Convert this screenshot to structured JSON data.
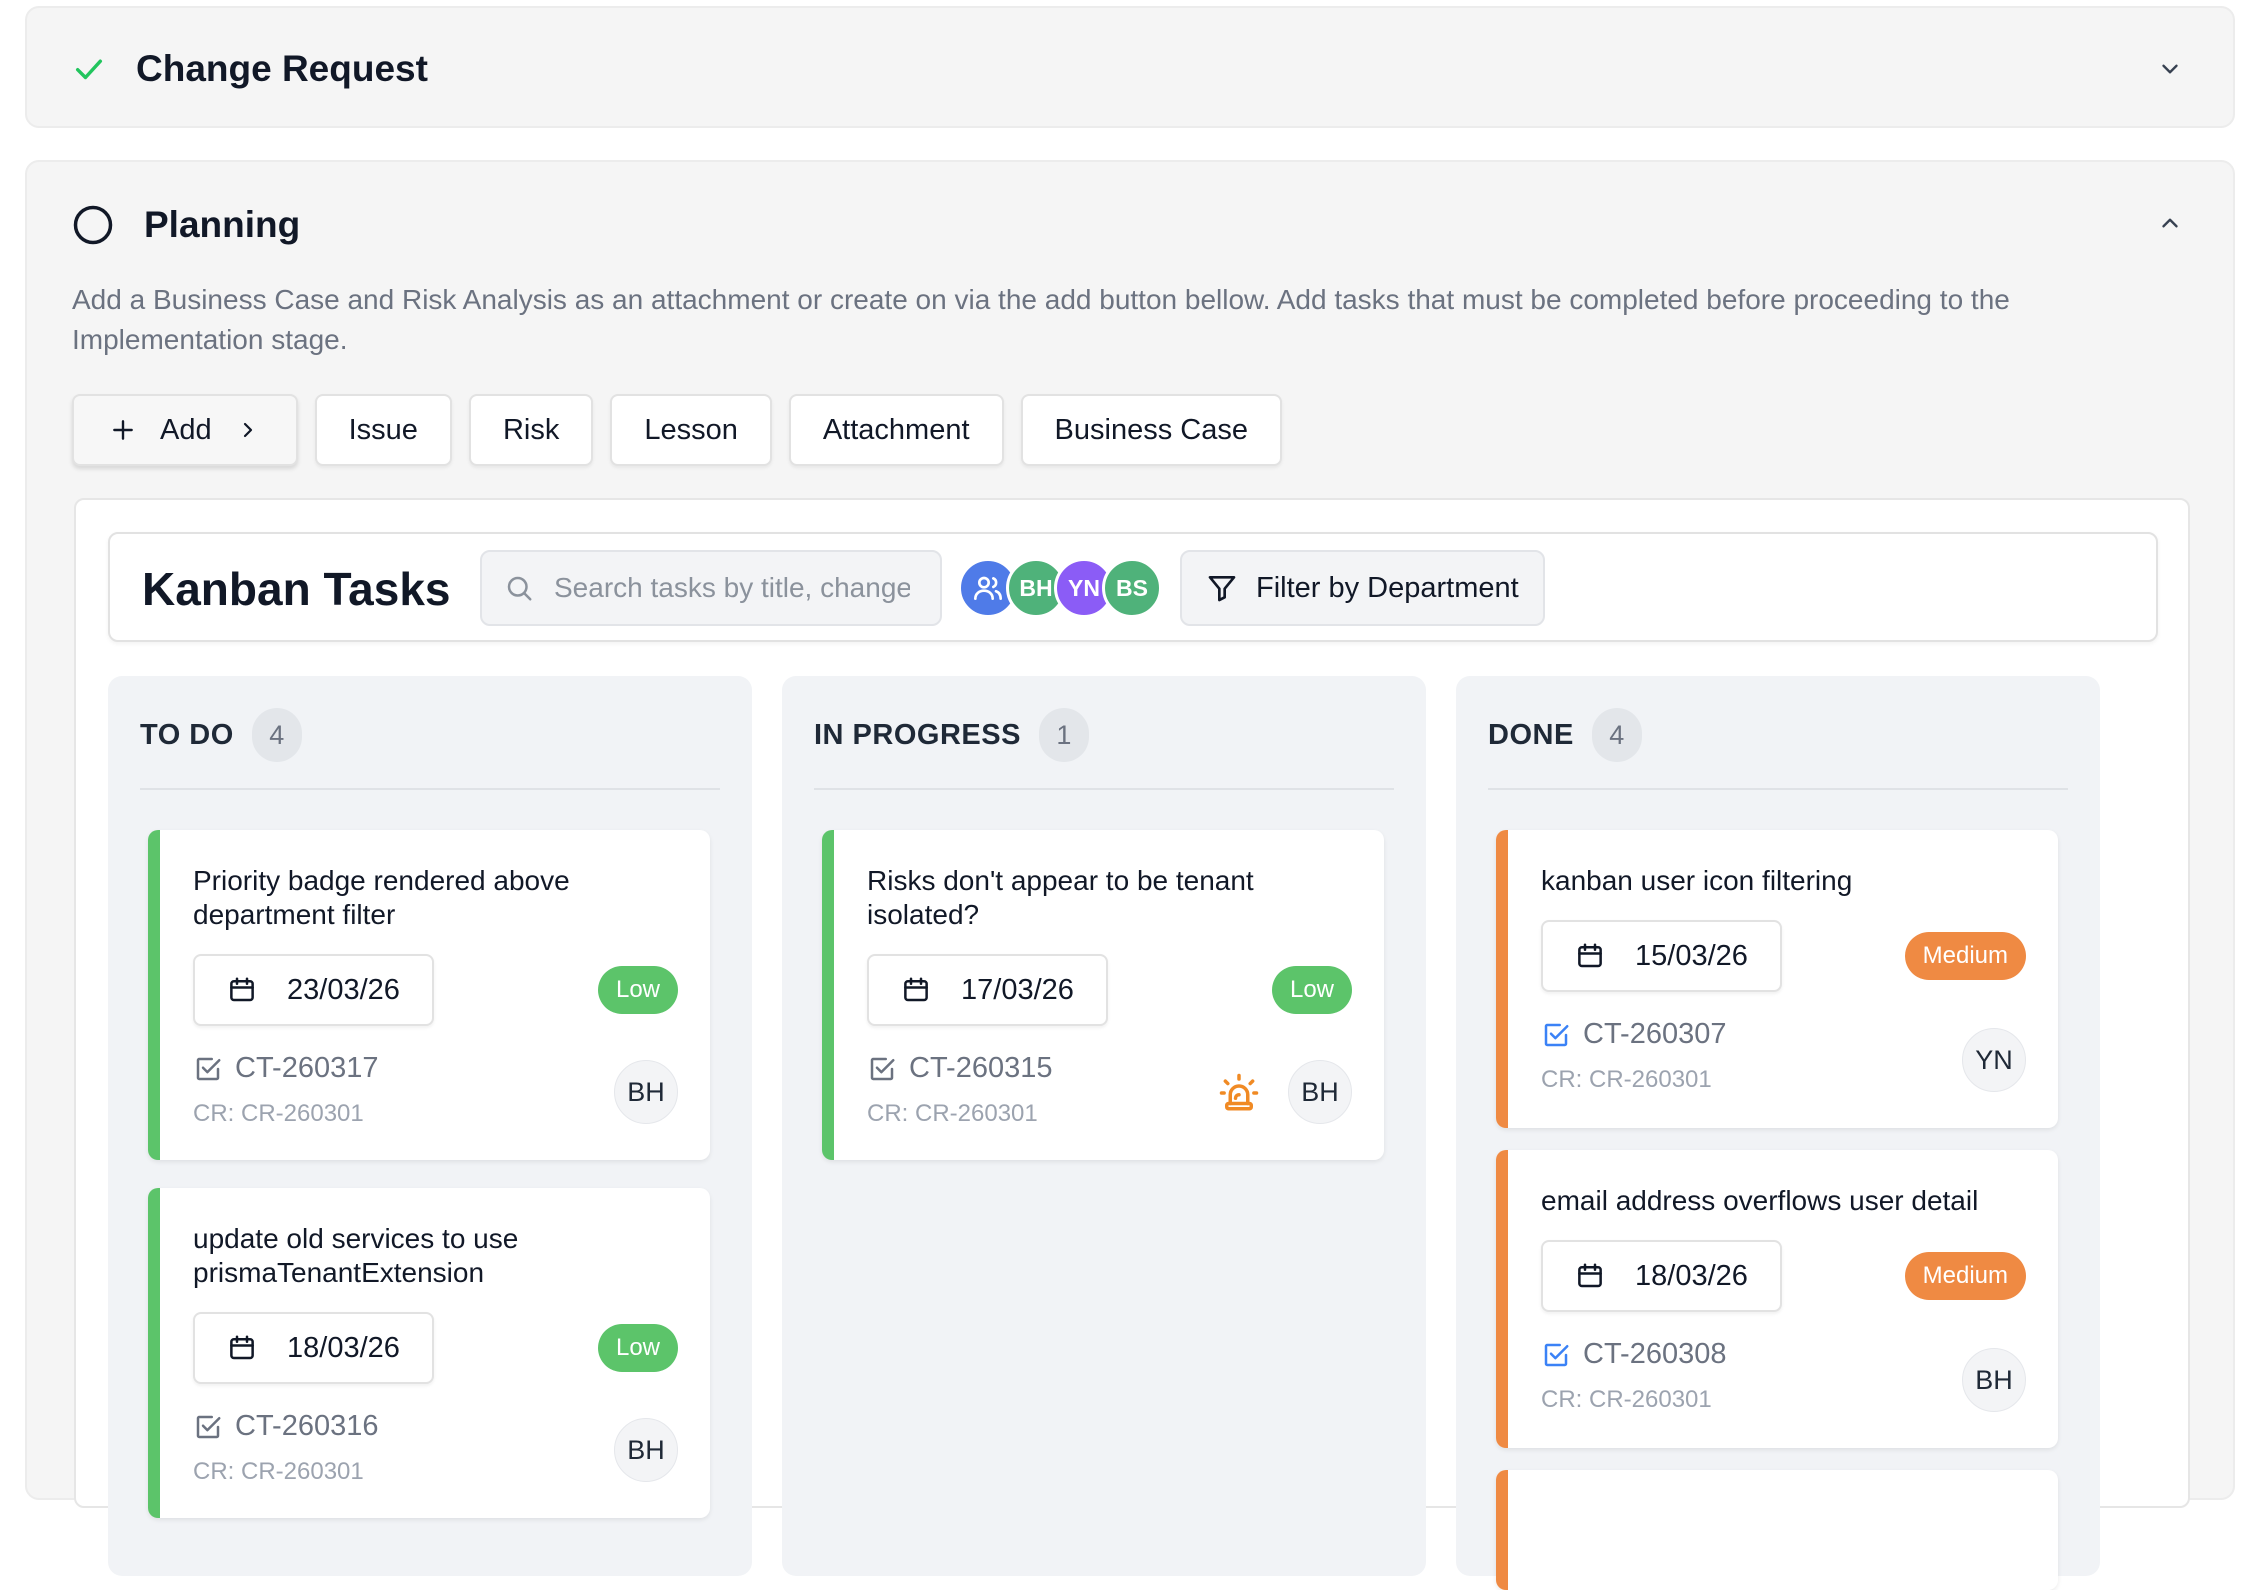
{
  "sections": {
    "change_request": {
      "title": "Change Request"
    },
    "planning": {
      "title": "Planning",
      "description": "Add a Business Case and Risk Analysis as an attachment or create on via the add button bellow. Add tasks that must be completed before proceeding to the Implementation stage."
    }
  },
  "actions": {
    "add_label": "Add",
    "buttons": [
      "Issue",
      "Risk",
      "Lesson",
      "Attachment",
      "Business Case"
    ]
  },
  "kanban": {
    "title": "Kanban Tasks",
    "search_placeholder": "Search tasks by title, change request...",
    "avatars": [
      {
        "initials": "",
        "icon": "users-icon",
        "color": "#4f7be8"
      },
      {
        "initials": "BH",
        "color": "#4fb27a"
      },
      {
        "initials": "YN",
        "color": "#8b5cf6"
      },
      {
        "initials": "BS",
        "color": "#4fb27a"
      }
    ],
    "filter_label": "Filter by Department",
    "columns": [
      {
        "title": "TO DO",
        "count": "4",
        "cards": [
          {
            "title": "Priority badge rendered above department filter",
            "date": "23/03/26",
            "priority": "Low",
            "code": "CT-260317",
            "cr": "CR: CR-260301",
            "assignee": "BH",
            "bar": "#5cc46a"
          },
          {
            "title": "update old services to use prismaTenantExtension",
            "date": "18/03/26",
            "priority": "Low",
            "code": "CT-260316",
            "cr": "CR: CR-260301",
            "assignee": "BH",
            "bar": "#5cc46a"
          }
        ]
      },
      {
        "title": "IN PROGRESS",
        "count": "1",
        "cards": [
          {
            "title": "Risks don't appear to be tenant isolated?",
            "date": "17/03/26",
            "priority": "Low",
            "code": "CT-260315",
            "cr": "CR: CR-260301",
            "assignee": "BH",
            "bar": "#5cc46a",
            "alert_icon": "siren-icon"
          }
        ]
      },
      {
        "title": "DONE",
        "count": "4",
        "cards": [
          {
            "title": "kanban user icon filtering",
            "date": "15/03/26",
            "priority": "Medium",
            "code": "CT-260307",
            "cr": "CR: CR-260301",
            "assignee": "YN",
            "bar": "#ef8a43"
          },
          {
            "title": "email address overflows user detail",
            "date": "18/03/26",
            "priority": "Medium",
            "code": "CT-260308",
            "cr": "CR: CR-260301",
            "assignee": "BH",
            "bar": "#ef8a43"
          }
        ]
      }
    ]
  },
  "colors": {
    "check": "#22c55e",
    "done_check": "#3b82f6",
    "alert": "#f08a24"
  }
}
